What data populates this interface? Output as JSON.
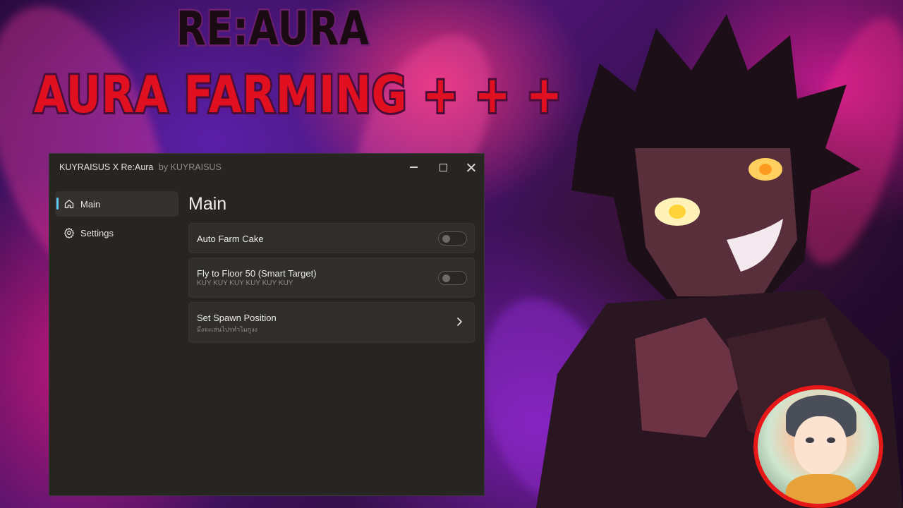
{
  "thumbnail": {
    "title_top": "RE:AURA",
    "title_main": "AURA FARMING + + +"
  },
  "window": {
    "title": "KUYRAISUS X Re:Aura",
    "subtitle": "by KUYRAISUS",
    "controls": [
      "minimize-icon",
      "maximize-icon",
      "close-icon"
    ]
  },
  "sidebar": {
    "items": [
      {
        "label": "Main",
        "icon": "home-icon",
        "active": true
      },
      {
        "label": "Settings",
        "icon": "gear-icon",
        "active": false
      }
    ]
  },
  "main": {
    "page_title": "Main",
    "cards": [
      {
        "title": "Auto Farm Cake",
        "type": "toggle",
        "enabled": false
      },
      {
        "title": "Fly to Floor 50 (Smart Target)",
        "description": "KUY KUY KUY KUY KUY KUY",
        "type": "toggle",
        "enabled": false
      },
      {
        "title": "Set Spawn Position",
        "description": "มึงจะเล่นไปรทำไมกูงง",
        "type": "button",
        "icon": "chevron-right-icon"
      }
    ]
  },
  "colors": {
    "accent": "#60c6f0",
    "window_bg": "#272522",
    "card_bg": "#302e2b",
    "title_red": "#e01020",
    "avatar_ring": "#e81818"
  }
}
